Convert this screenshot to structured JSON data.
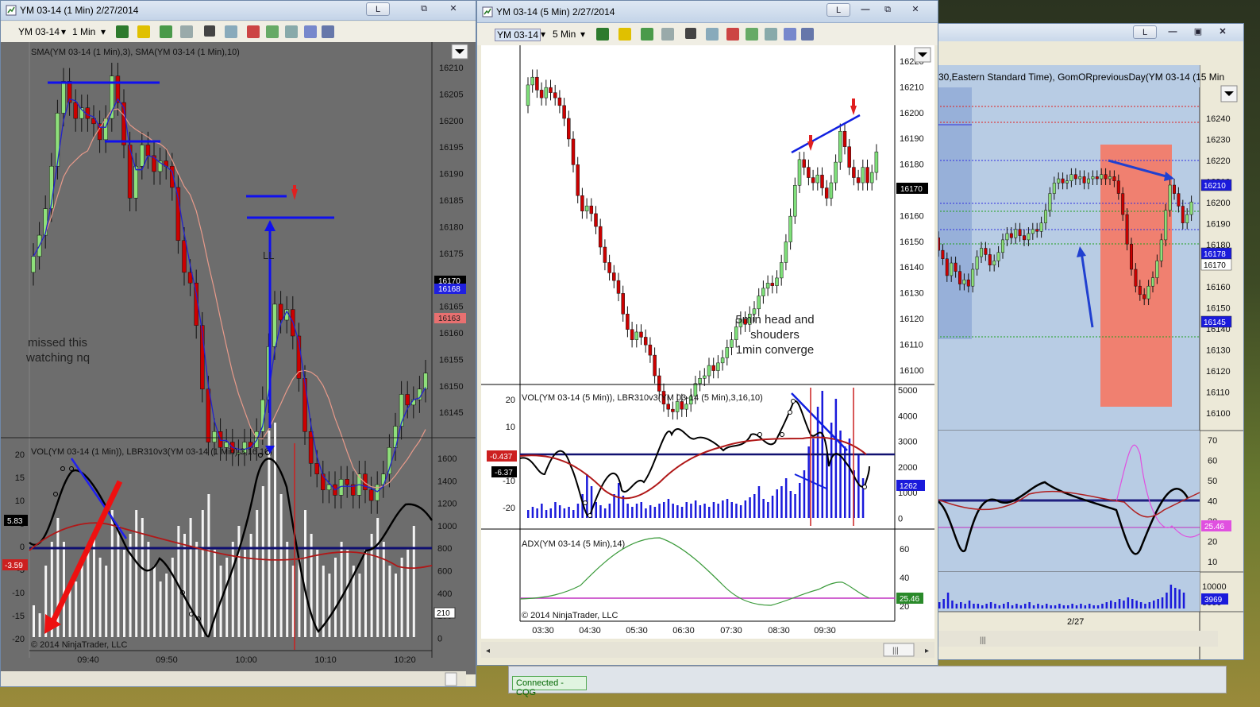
{
  "windows": {
    "left": {
      "title": "YM 03-14 (1 Min)  2/27/2014",
      "instrument": "YM 03-14",
      "interval": "1 Min",
      "price_indicator_label": "SMA(YM 03-14 (1 Min),3), SMA(YM 03-14 (1 Min),10)",
      "vol_indicator_label": "VOL(YM 03-14 (1 Min)), LBR310v3(YM 03-14 (1 Min),3,16,10)",
      "price_axis": [
        "16210",
        "16205",
        "16200",
        "16195",
        "16190",
        "16185",
        "16180",
        "16175",
        "16170",
        "16165",
        "16160",
        "16155",
        "16150",
        "16145"
      ],
      "price_badges": {
        "last": "16170",
        "blue": "16168",
        "red": "16163"
      },
      "vol_axis_left": [
        "20",
        "15",
        "10",
        "5",
        "0",
        "-5",
        "-10",
        "-15",
        "-20"
      ],
      "vol_axis_right": [
        "1600",
        "1400",
        "1200",
        "1000",
        "800",
        "600",
        "400",
        "200",
        "0"
      ],
      "osc_badges": {
        "a": "5.83",
        "b": "-3.59",
        "vol": "210"
      },
      "time_axis": [
        "09:40",
        "09:50",
        "10:00",
        "10:10",
        "10:20"
      ],
      "annotation_ll": "LL",
      "annotation_note_1": "missed this",
      "annotation_note_2": "watching nq",
      "copyright": "© 2014 NinjaTrader, LLC",
      "colors": {
        "bg": "#6d6d6d",
        "up": "#8ee07a",
        "down": "#cc0000",
        "sma3": "#2222cc",
        "sma10": "#e89a8a"
      }
    },
    "middle": {
      "title": "YM 03-14 (5 Min)  2/27/2014",
      "instrument": "YM 03-14",
      "interval": "5 Min",
      "price_axis": [
        "16220",
        "16210",
        "16200",
        "16190",
        "16180",
        "16170",
        "16160",
        "16150",
        "16140",
        "16130",
        "16120",
        "16110",
        "16100"
      ],
      "price_badge": "16170",
      "annotation_1": "5min head and",
      "annotation_2": "shouders",
      "annotation_3": "1min converge",
      "vol_indicator_label": "VOL(YM 03-14 (5 Min)), LBR310v3(YM 03-14 (5 Min),3,16,10)",
      "vol_axis_left": [
        "20",
        "10",
        "0",
        "-10",
        "-20"
      ],
      "vol_axis_right": [
        "5000",
        "4000",
        "3000",
        "2000",
        "1000",
        "0"
      ],
      "osc_badges": {
        "a": "-0.437",
        "b": "-6.37",
        "vol": "1262"
      },
      "adx_label": "ADX(YM 03-14 (5 Min),14)",
      "adx_axis": [
        "60",
        "40",
        "20"
      ],
      "adx_badge": "25.46",
      "copyright": "© 2014 NinjaTrader, LLC",
      "time_axis": [
        "03:30",
        "04:30",
        "05:30",
        "06:30",
        "07:30",
        "08:30",
        "09:30"
      ],
      "colors": {
        "bg": "#ffffff",
        "up": "#7fe07a",
        "down": "#cc0000"
      }
    },
    "right": {
      "indicator_label": "30,Eastern Standard Time), GomORpreviousDay(YM 03-14 (15 Min",
      "price_axis": [
        "16240",
        "16230",
        "16220",
        "16210",
        "16200",
        "16190",
        "16180",
        "16170",
        "16160",
        "16150",
        "16140",
        "16130",
        "16120",
        "16110",
        "16100"
      ],
      "price_badges": {
        "blue": "16210",
        "a": "16178",
        "b": "16170",
        "c": "16145"
      },
      "osc_axis": [
        "70",
        "60",
        "50",
        "40",
        "30",
        "20",
        "10"
      ],
      "osc_badge": "25.46",
      "vol_axis": [
        "10000",
        "5000"
      ],
      "vol_badge": "3969",
      "date_label": "2/27",
      "colors": {
        "bg": "#b8cce4",
        "band": "#f08070"
      }
    }
  },
  "status": {
    "connection": "Connected - CQG"
  },
  "buttons": {
    "link": "L",
    "restore": "⧉",
    "minimize": "—",
    "close": "✕"
  }
}
